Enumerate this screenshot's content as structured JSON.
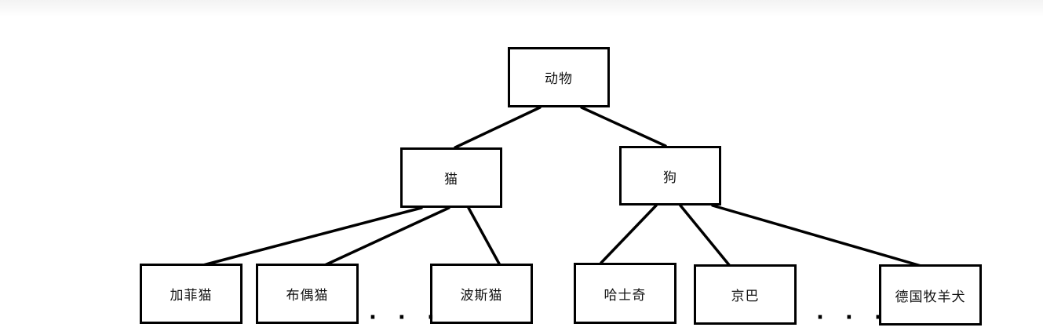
{
  "diagram": {
    "root": {
      "label": "动物"
    },
    "level1": [
      {
        "id": "cat",
        "label": "猫"
      },
      {
        "id": "dog",
        "label": "狗"
      }
    ],
    "leaves": [
      {
        "id": "garfield",
        "label": "加菲猫"
      },
      {
        "id": "ragdoll",
        "label": "布偶猫"
      },
      {
        "id": "persian",
        "label": "波斯猫"
      },
      {
        "id": "husky",
        "label": "哈士奇"
      },
      {
        "id": "pekingese",
        "label": "京巴"
      },
      {
        "id": "german-shepherd",
        "label": "德国牧羊犬"
      }
    ],
    "ellipsis": "· · ·",
    "edges": [
      {
        "from": "root",
        "to": "cat"
      },
      {
        "from": "root",
        "to": "dog"
      },
      {
        "from": "cat",
        "to": "garfield"
      },
      {
        "from": "cat",
        "to": "ragdoll"
      },
      {
        "from": "cat",
        "to": "persian"
      },
      {
        "from": "dog",
        "to": "husky"
      },
      {
        "from": "dog",
        "to": "pekingese"
      },
      {
        "from": "dog",
        "to": "german-shepherd"
      }
    ]
  }
}
